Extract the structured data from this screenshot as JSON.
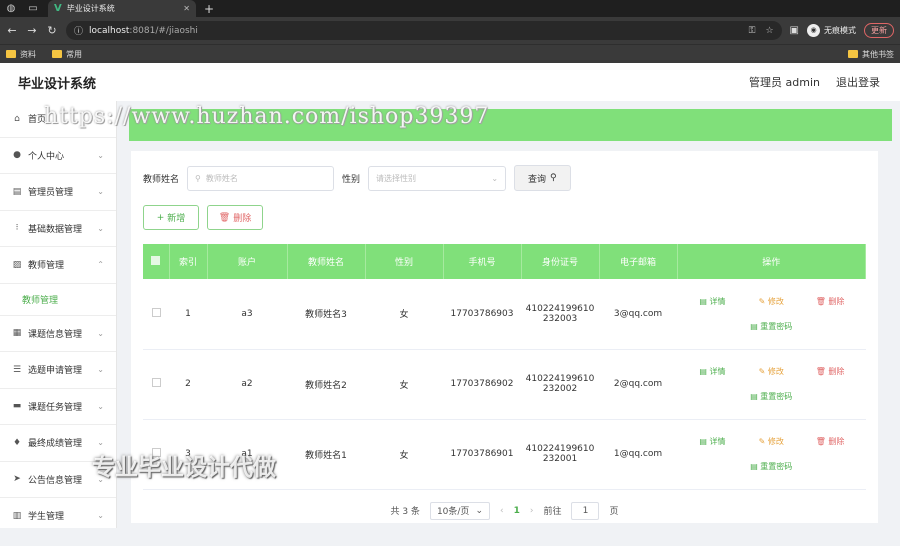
{
  "browser": {
    "tab_title": "毕业设计系统",
    "url_host": "localhost",
    "url_port_path": ":8081/#/jiaoshi",
    "profile_label": "无痕模式",
    "update_label": "更新",
    "bookmarks": [
      "资料",
      "常用"
    ],
    "bookmarks_right": "其他书签"
  },
  "app": {
    "title": "毕业设计系统",
    "user_label": "管理员 admin",
    "logout_label": "退出登录"
  },
  "sidebar": {
    "items": [
      {
        "label": "首页",
        "icon": "home-icon"
      },
      {
        "label": "个人中心",
        "icon": "user-icon"
      },
      {
        "label": "管理员管理",
        "icon": "clipboard-icon"
      },
      {
        "label": "基础数据管理",
        "icon": "grid-icon"
      },
      {
        "label": "教师管理",
        "icon": "image-icon",
        "expanded": true
      },
      {
        "label": "课题信息管理",
        "icon": "chart-icon"
      },
      {
        "label": "选题申请管理",
        "icon": "list-icon"
      },
      {
        "label": "课题任务管理",
        "icon": "monitor-icon"
      },
      {
        "label": "最终成绩管理",
        "icon": "bulb-icon"
      },
      {
        "label": "公告信息管理",
        "icon": "send-icon"
      },
      {
        "label": "学生管理",
        "icon": "bars-icon"
      }
    ],
    "sub_item": "教师管理"
  },
  "search": {
    "name_label": "教师姓名",
    "name_placeholder": "教师姓名",
    "gender_label": "性别",
    "gender_placeholder": "请选择性别",
    "query_label": "查询"
  },
  "actions": {
    "add_label": "新增",
    "delete_label": "删除"
  },
  "table": {
    "headers": [
      "索引",
      "账户",
      "教师姓名",
      "性别",
      "手机号",
      "身份证号",
      "电子邮箱",
      "操作"
    ],
    "rows": [
      {
        "index": "1",
        "account": "a3",
        "name": "教师姓名3",
        "gender": "女",
        "phone": "17703786903",
        "id_1": "410224199610",
        "id_2": "232003",
        "email": "3@qq.com"
      },
      {
        "index": "2",
        "account": "a2",
        "name": "教师姓名2",
        "gender": "女",
        "phone": "17703786902",
        "id_1": "410224199610",
        "id_2": "232002",
        "email": "2@qq.com"
      },
      {
        "index": "3",
        "account": "a1",
        "name": "教师姓名1",
        "gender": "女",
        "phone": "17703786901",
        "id_1": "410224199610",
        "id_2": "232001",
        "email": "1@qq.com"
      }
    ],
    "op_detail": "详情",
    "op_edit": "修改",
    "op_delete": "删除",
    "op_reset": "重置密码"
  },
  "pagination": {
    "total": "共 3 条",
    "page_size": "10条/页",
    "current": "1",
    "goto_label": "前往",
    "goto_value": "1",
    "page_suffix": "页"
  },
  "watermarks": {
    "url": "https://www.huzhan.com/ishop39397",
    "promo": "专业毕业设计代做"
  },
  "colors": {
    "accent": "#80e07a",
    "link_green": "#4cae4c",
    "danger": "#e06666",
    "warning": "#e6a23c"
  }
}
